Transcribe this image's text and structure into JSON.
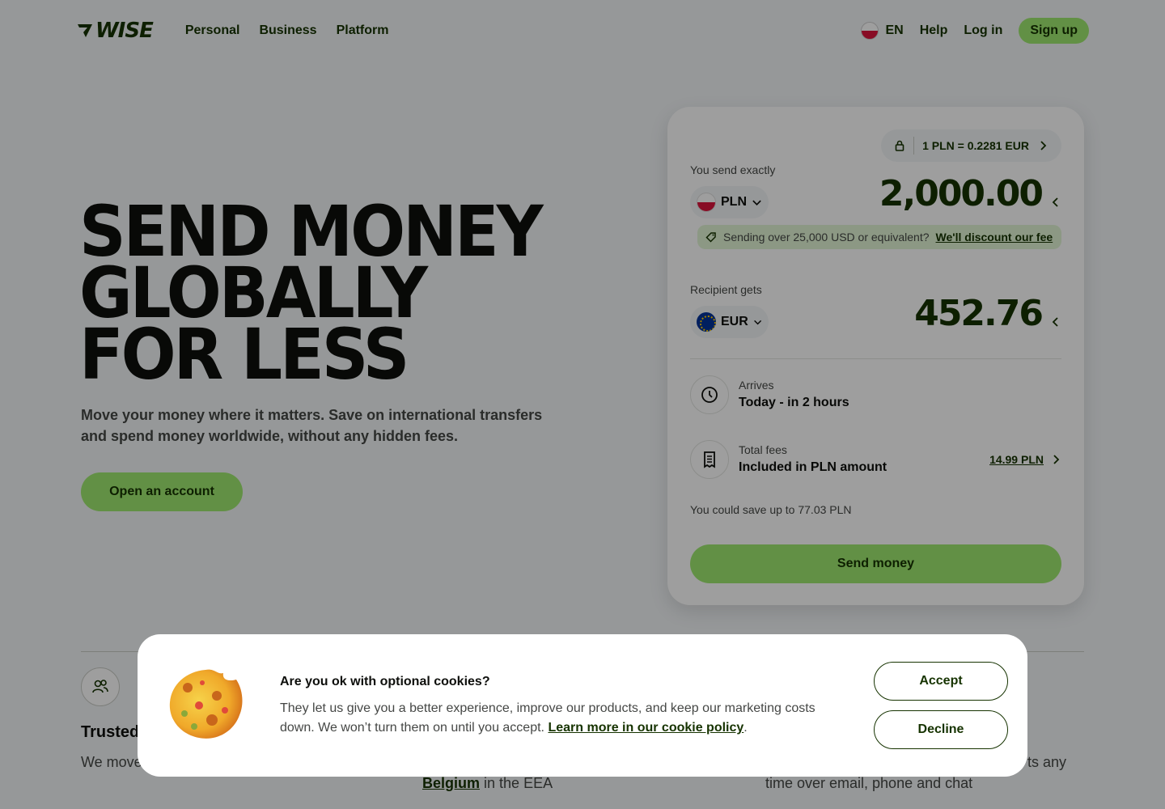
{
  "header": {
    "logo_text": "WISE",
    "nav": [
      "Personal",
      "Business",
      "Platform"
    ],
    "language": "EN",
    "help": "Help",
    "login": "Log in",
    "signup": "Sign up"
  },
  "hero": {
    "title_lines": [
      "SEND MONEY",
      "GLOBALLY",
      "FOR LESS"
    ],
    "subtitle": "Move your money where it matters. Save on international transfers and spend money worldwide, without any hidden fees.",
    "cta": "Open an account"
  },
  "calculator": {
    "rate": "1 PLN = 0.2281 EUR",
    "send_label": "You send exactly",
    "send_currency": "PLN",
    "send_amount": "2,000.00",
    "discount_text": "Sending over 25,000 USD or equivalent?",
    "discount_link": "We'll discount our fee",
    "receive_label": "Recipient gets",
    "receive_currency": "EUR",
    "receive_amount": "452.76",
    "arrives_label": "Arrives",
    "arrives_value": "Today - in 2 hours",
    "fees_label": "Total fees",
    "fees_value": "Included in PLN amount",
    "fees_amount": "14.99 PLN",
    "save_text": "You could save up to 77.03 PLN",
    "send_button": "Send money"
  },
  "below": {
    "feature_title": "Trusted",
    "feature_text_1": "We move",
    "feature_link_2": "Belgium",
    "feature_text_2": "in the EEA",
    "feature_text_3a": "ts any",
    "feature_text_3b": "time over email, phone and chat"
  },
  "cookie": {
    "title": "Are you ok with optional cookies?",
    "text": "They let us give you a better experience, improve our products, and keep our marketing costs down. We won’t turn them on until you accept.",
    "link": "Learn more in our cookie policy",
    "accept": "Accept",
    "decline": "Decline"
  },
  "colors": {
    "brand_green": "#9fe870",
    "forest_green": "#163300",
    "overlay": "rgba(0,0,0,0.38)"
  }
}
